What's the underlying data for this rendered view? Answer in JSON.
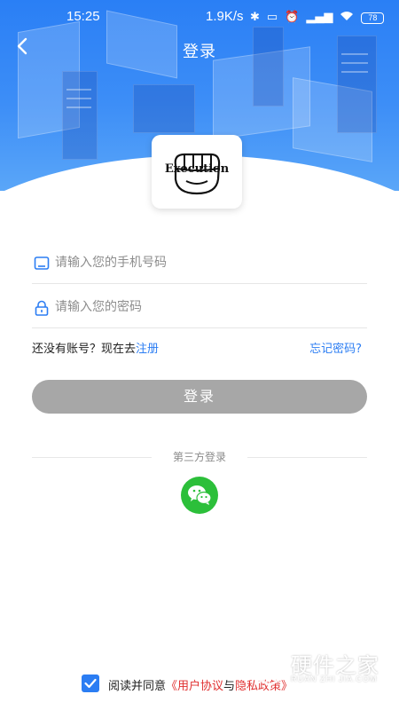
{
  "status_bar": {
    "time": "15:25",
    "network_speed": "1.9K/s",
    "battery": "78"
  },
  "nav": {
    "title": "登录"
  },
  "logo": {
    "text": "Execution"
  },
  "form": {
    "phone_placeholder": "请输入您的手机号码",
    "password_placeholder": "请输入您的密码",
    "no_account_text": "还没有账号？现在去",
    "register_link": "注册",
    "forgot_link": "忘记密码?",
    "login_button": "登录"
  },
  "third_party": {
    "label": "第三方登录"
  },
  "agreement": {
    "checked": true,
    "prefix": "阅读并同意",
    "user_agreement": "《用户协议",
    "conjunction": "与",
    "privacy_policy": "隐私政策》"
  },
  "watermark": {
    "brand": "硬件之家",
    "sub": "RUAN ZHI JIA.COM"
  },
  "colors": {
    "brand_blue": "#2b7df3",
    "button_disabled": "#a7a7a7",
    "wechat_green": "#2cbf3a",
    "link_red": "#e03030"
  }
}
